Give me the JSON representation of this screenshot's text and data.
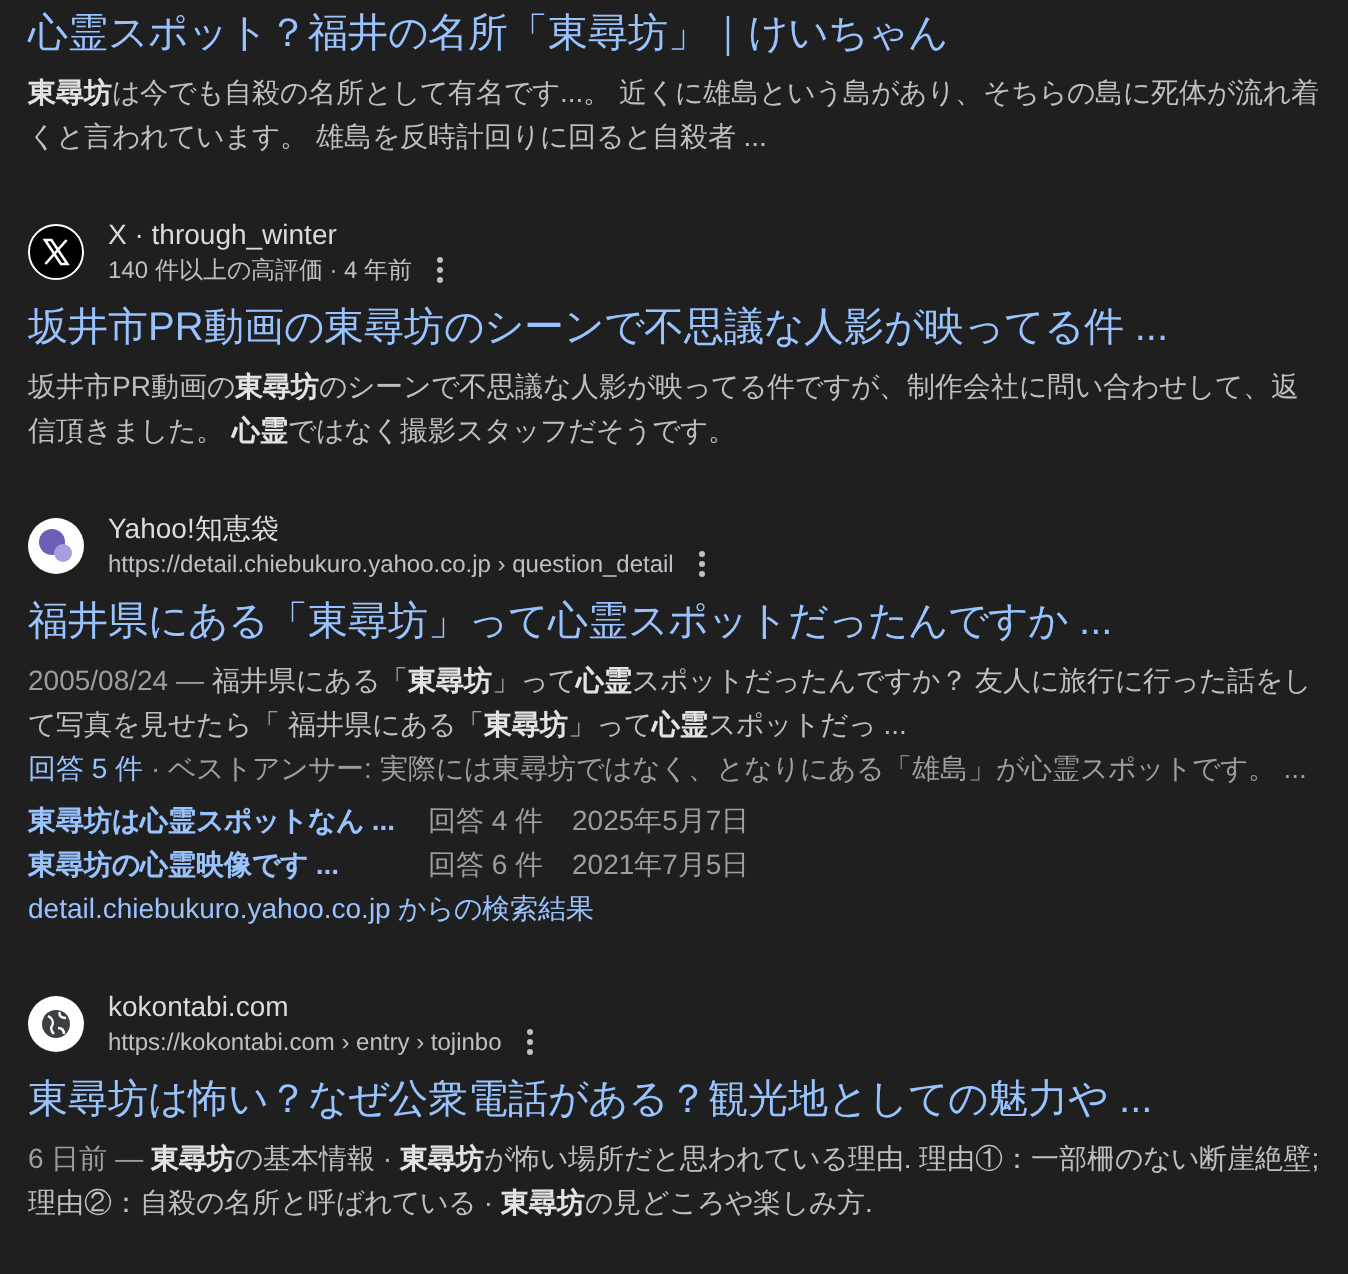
{
  "results": [
    {
      "kind": "plain",
      "title": "心霊スポット？福井の名所「東尋坊」｜けいちゃん",
      "snippet": "**東尋坊**は今でも自殺の名所として有名です...。 近くに雄島という島があり、そちらの島に死体が流れ着くと言われています。 雄島を反時計回りに回ると自殺者 ..."
    },
    {
      "kind": "social",
      "site": "X · through_winter",
      "meta": "140 件以上の高評価 · 4 年前",
      "title": "坂井市PR動画の東尋坊のシーンで不思議な人影が映ってる件 ...",
      "snippet": "坂井市PR動画の**東尋坊**のシーンで不思議な人影が映ってる件ですが、制作会社に問い合わせして、返信頂きました。 **心霊**ではなく撮影スタッフだそうです。"
    },
    {
      "kind": "qa",
      "site": "Yahoo!知恵袋",
      "meta": "https://detail.chiebukuro.yahoo.co.jp › question_detail",
      "title": "福井県にある「東尋坊」って心霊スポットだったんですか ...",
      "date": "2005/08/24 — ",
      "snippet": "福井県にある「**東尋坊**」って**心霊**スポットだったんですか？ 友人に旅行に行った話をして写真を見せたら「 福井県にある「**東尋坊**」って**心霊**スポットだっ ...",
      "answer_link": "回答 5 件",
      "answer_text": " · ベストアンサー: 実際には東尋坊ではなく、となりにある「雄島」が心霊スポットです。 ...",
      "related": [
        {
          "title": "東尋坊は心霊スポットなん ...",
          "count": "回答 4 件",
          "date": "2025年5月7日"
        },
        {
          "title": "東尋坊の心霊映像です ...",
          "count": "回答 6 件",
          "date": "2021年7月5日"
        }
      ],
      "more": "detail.chiebukuro.yahoo.co.jp からの検索結果"
    },
    {
      "kind": "web",
      "site": "kokontabi.com",
      "meta": "https://kokontabi.com › entry › tojinbo",
      "title": "東尋坊は怖い？なぜ公衆電話がある？観光地としての魅力や ...",
      "date": "6 日前 — ",
      "snippet": "**東尋坊**の基本情報 · **東尋坊**が怖い場所だと思われている理由. 理由①：一部柵のない断崖絶壁; 理由②：自殺の名所と呼ばれている · **東尋坊**の見どころや楽しみ方."
    }
  ]
}
